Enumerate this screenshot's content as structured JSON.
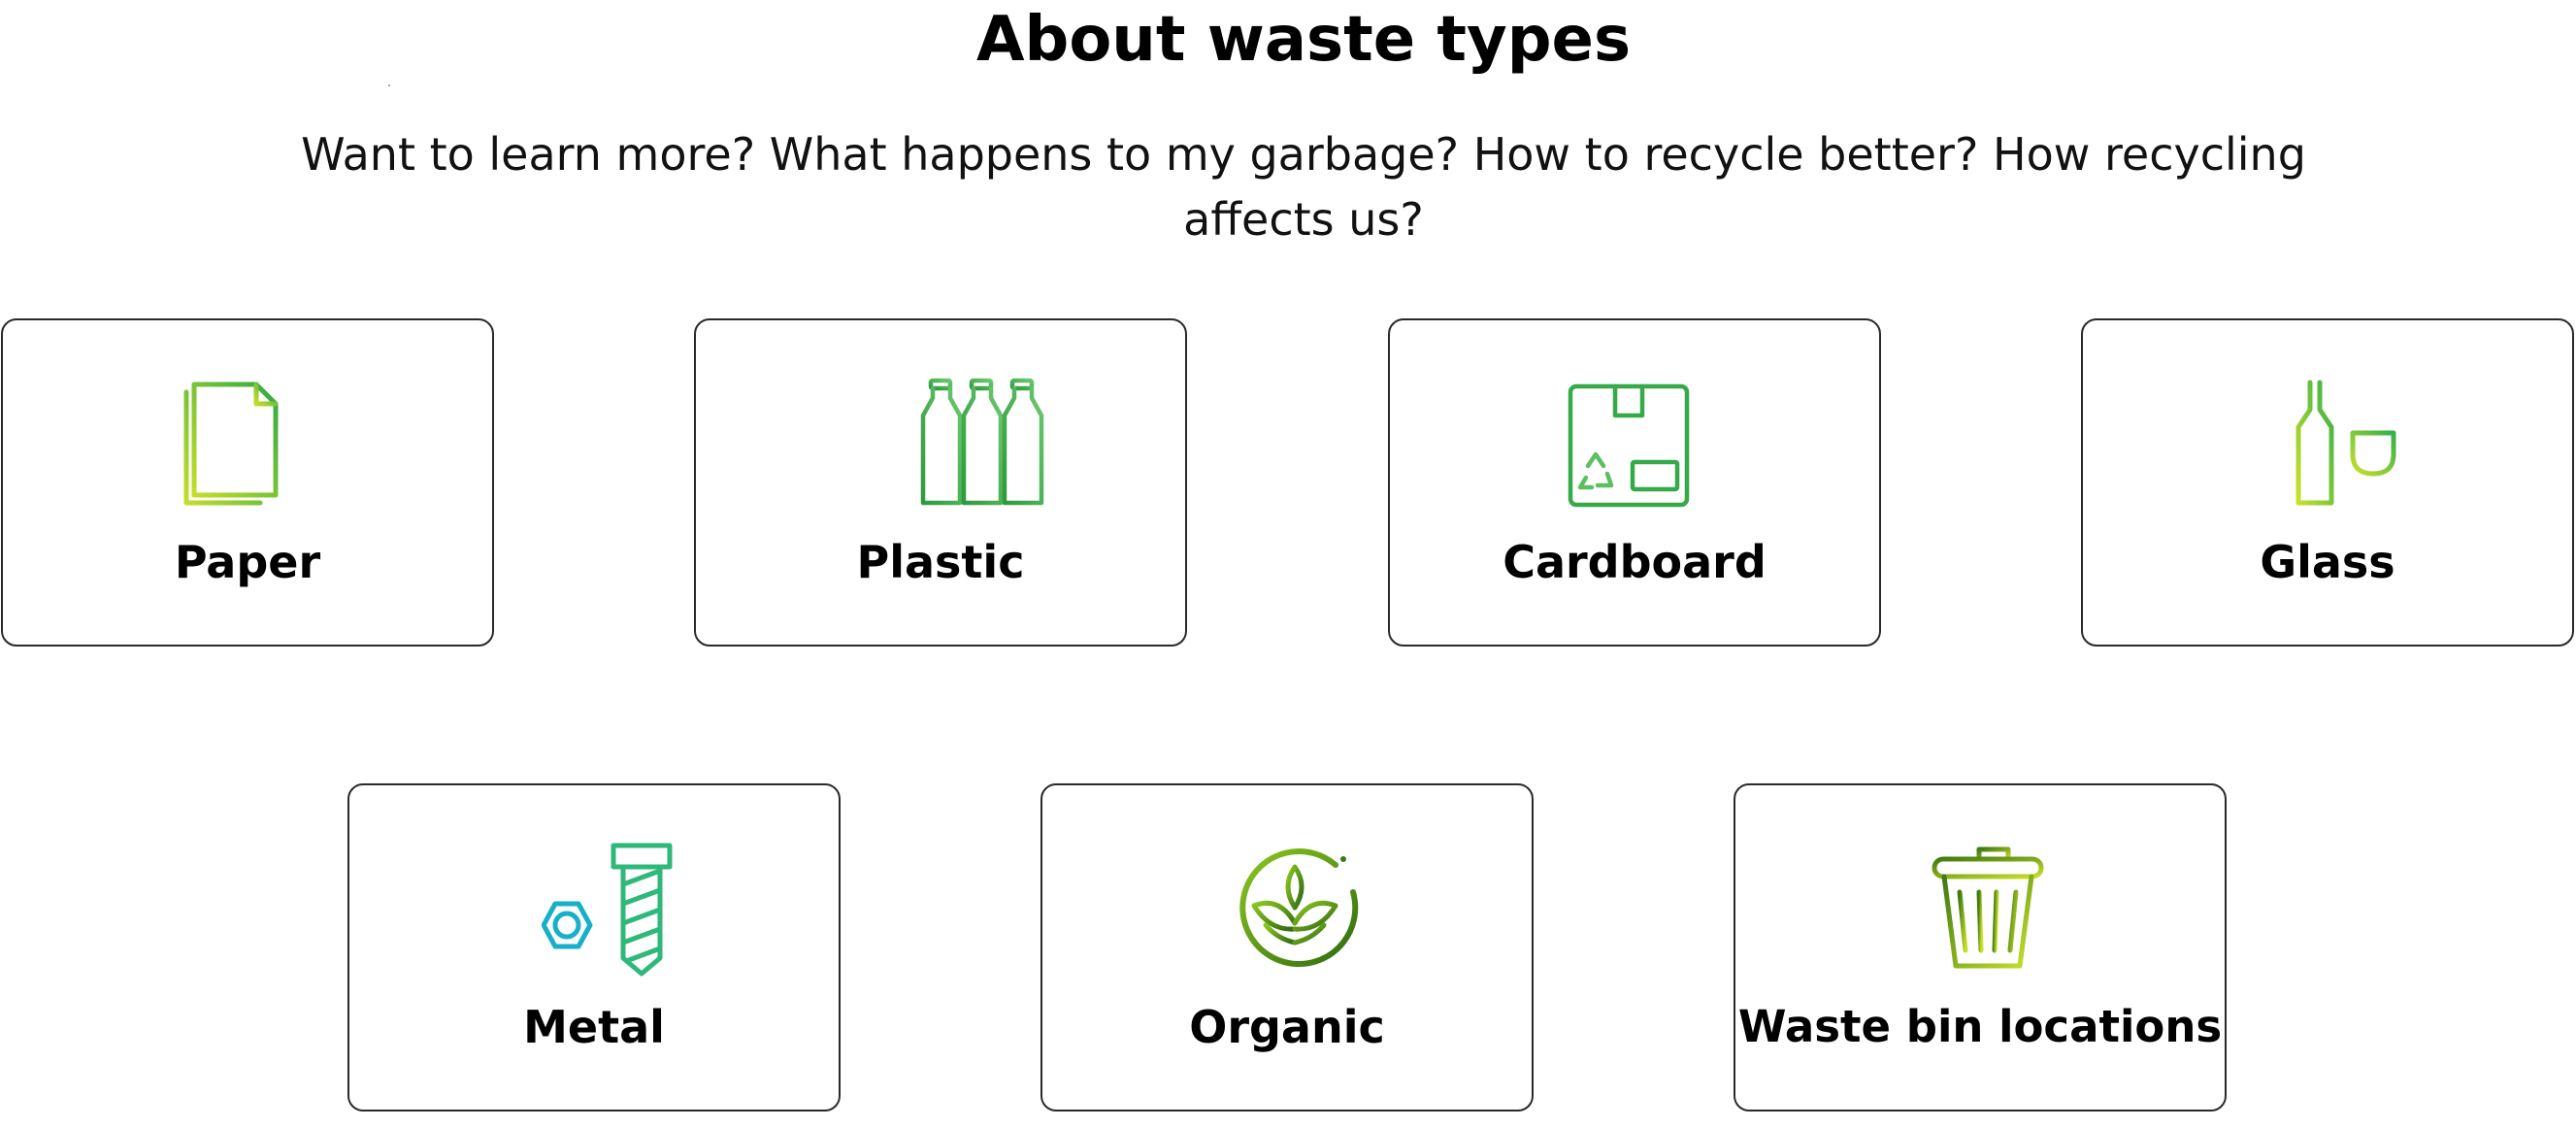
{
  "page": {
    "title": "About waste types",
    "subtitle": "Want to learn more? What happens to my garbage? How to recycle better? How recycling affects us?"
  },
  "colors": {
    "green_light": "#c4dd2a",
    "green_mid": "#4cbb5a",
    "green_dark": "#2e9a3e",
    "olive_dark": "#3f7a10",
    "teal": "#16b0c8",
    "teal_green": "#2eb87a",
    "card_border": "#2a2a2a"
  },
  "cards": [
    {
      "label": "Paper",
      "icon": "paper-documents-icon"
    },
    {
      "label": "Plastic",
      "icon": "plastic-bottles-icon"
    },
    {
      "label": "Cardboard",
      "icon": "cardboard-box-icon"
    },
    {
      "label": "Glass",
      "icon": "glass-bottle-and-wineglass-icon"
    },
    {
      "label": "Metal",
      "icon": "bolt-and-nut-icon"
    },
    {
      "label": "Organic",
      "icon": "leaf-sprout-icon"
    },
    {
      "label": "Waste bin locations",
      "icon": "trash-bin-icon"
    }
  ]
}
